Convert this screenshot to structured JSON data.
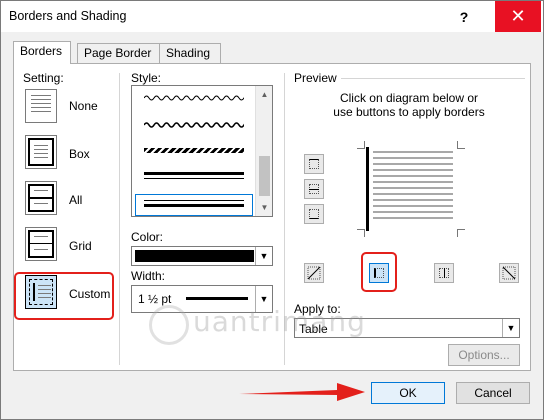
{
  "window": {
    "title": "Borders and Shading",
    "help_glyph": "?",
    "close_glyph": "✕"
  },
  "tabs": [
    {
      "label": "Borders",
      "active": true
    },
    {
      "label": "Page Border",
      "active": false
    },
    {
      "label": "Shading",
      "active": false
    }
  ],
  "setting": {
    "label": "Setting:",
    "options": [
      {
        "label": "None"
      },
      {
        "label": "Box"
      },
      {
        "label": "All"
      },
      {
        "label": "Grid"
      },
      {
        "label": "Custom",
        "selected": true
      }
    ]
  },
  "style": {
    "label": "Style:"
  },
  "color": {
    "label": "Color:",
    "value_hex": "#000000"
  },
  "width": {
    "label": "Width:",
    "value": "1 ½ pt"
  },
  "preview": {
    "label": "Preview",
    "instruction_line1": "Click on diagram below or",
    "instruction_line2": "use buttons to apply borders"
  },
  "apply_to": {
    "label": "Apply to:",
    "value": "Table"
  },
  "buttons": {
    "options": "Options...",
    "ok": "OK",
    "cancel": "Cancel"
  },
  "watermark": {
    "text": "uantrimang"
  },
  "colors": {
    "accent_red": "#e3201b",
    "close_red": "#e81123",
    "focus_blue": "#0078d7"
  }
}
